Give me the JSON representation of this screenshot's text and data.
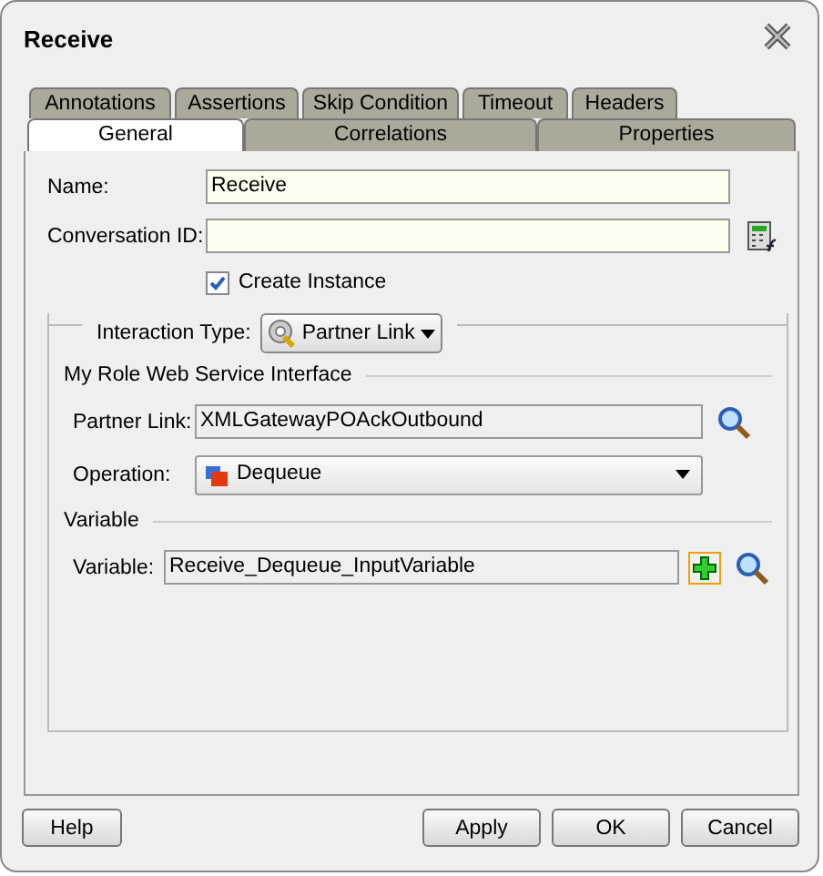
{
  "window": {
    "title": "Receive"
  },
  "tab_rows": [
    [
      {
        "label": "Annotations",
        "selected": false
      },
      {
        "label": "Assertions",
        "selected": false
      },
      {
        "label": "Skip Condition",
        "selected": false
      },
      {
        "label": "Timeout",
        "selected": false
      },
      {
        "label": "Headers",
        "selected": false
      }
    ],
    [
      {
        "label": "General",
        "selected": true
      },
      {
        "label": "Correlations",
        "selected": false
      },
      {
        "label": "Properties",
        "selected": false
      }
    ]
  ],
  "name": {
    "label": "Name:",
    "value": "Receive"
  },
  "conversation_id": {
    "label": "Conversation ID:"
  },
  "create_instance": {
    "label": "Create Instance",
    "checked": true
  },
  "interaction_type": {
    "label": "Interaction Type:",
    "value": "Partner Link"
  },
  "my_role": {
    "title": "My Role Web Service Interface",
    "partner_link": {
      "label": "Partner Link:",
      "value": "XMLGatewayPOAckOutbound"
    },
    "operation": {
      "label": "Operation:",
      "value": "Dequeue"
    }
  },
  "variable_section": {
    "title": "Variable",
    "label": "Variable:",
    "value": "Receive_Dequeue_InputVariable"
  },
  "buttons": [
    {
      "label": "Help",
      "kind": "left"
    },
    {
      "label": "Apply",
      "kind": "right"
    },
    {
      "label": "OK",
      "kind": "right"
    },
    {
      "label": "Cancel",
      "kind": "right"
    }
  ]
}
